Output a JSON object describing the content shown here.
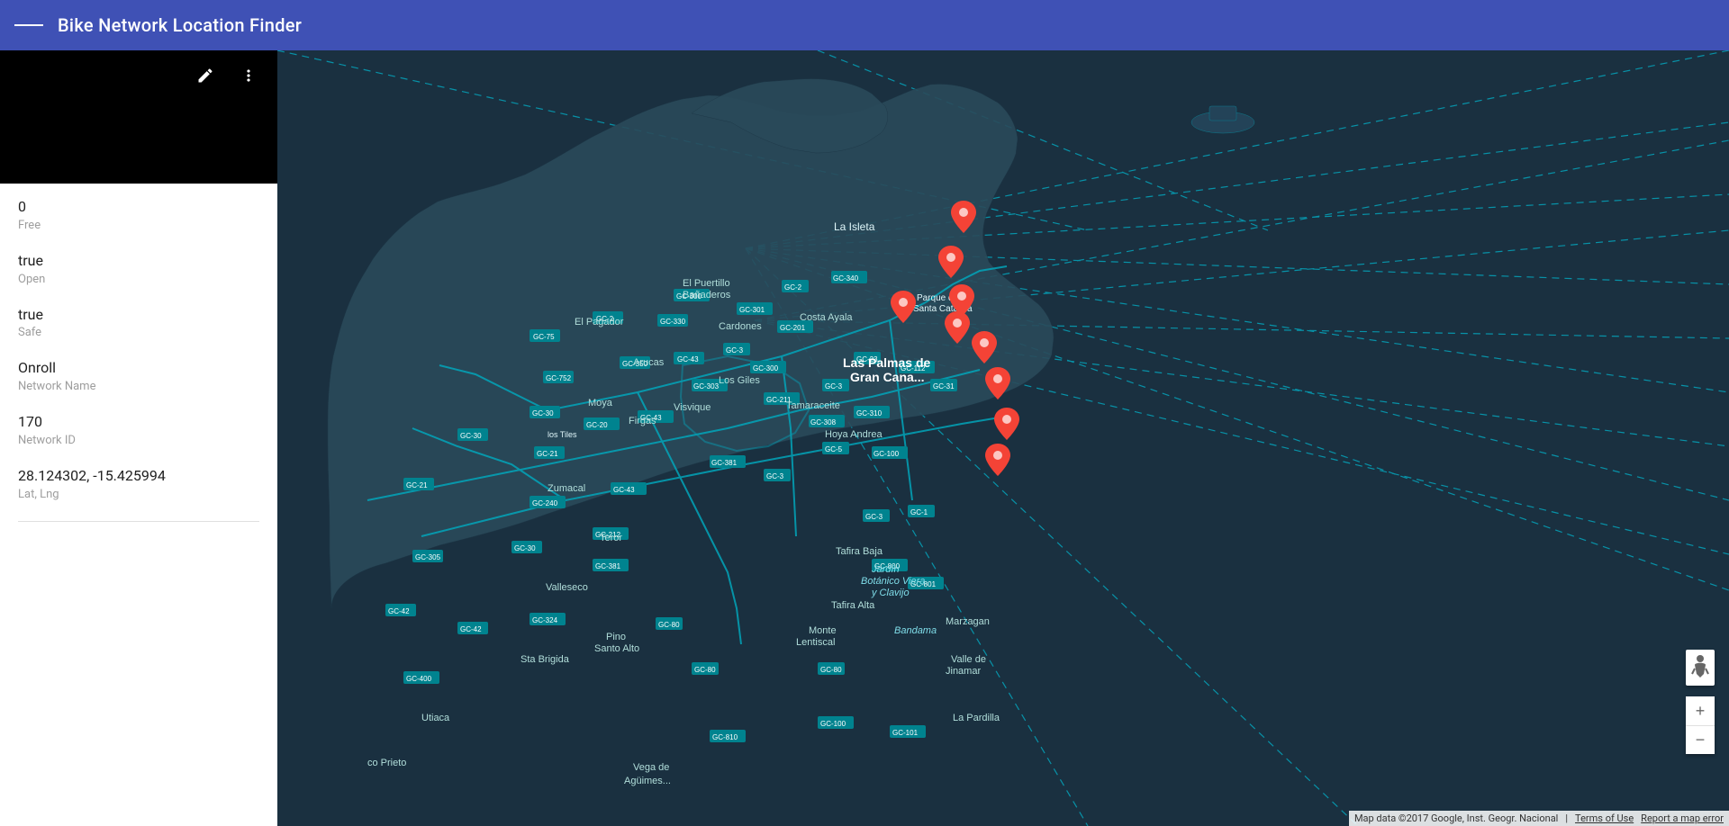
{
  "header": {
    "title": "Bike Network Location Finder",
    "menu_icon": "☰"
  },
  "sidebar": {
    "edit_icon": "✏",
    "more_icon": "⋮",
    "info_rows": [
      {
        "value": "0",
        "label": "Free"
      },
      {
        "value": "true",
        "label": "Open"
      },
      {
        "value": "true",
        "label": "Safe"
      },
      {
        "value": "Onroll",
        "label": "Network Name"
      },
      {
        "value": "170",
        "label": "Network ID"
      },
      {
        "value": "28.124302, -15.425994",
        "label": "Lat, Lng"
      }
    ]
  },
  "map": {
    "attribution": "Map data ©2017 Google, Inst. Geogr. Nacional",
    "terms_label": "Terms of Use",
    "report_label": "Report a map error"
  },
  "zoom": {
    "plus_label": "+",
    "minus_label": "−"
  }
}
